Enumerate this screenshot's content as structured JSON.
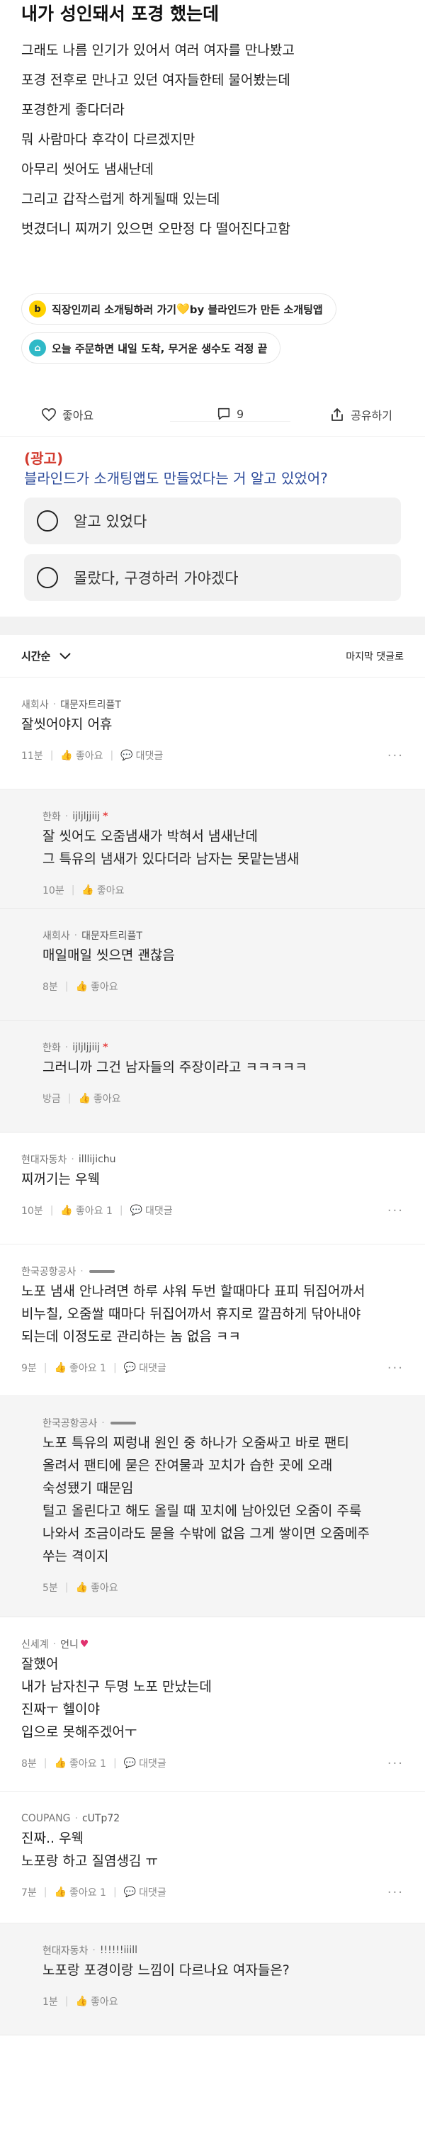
{
  "post": {
    "title": "내가 성인돼서 포경 했는데",
    "lines": [
      "그래도 나름 인기가 있어서 여러 여자를 만나봤고",
      "포경 전후로 만나고 있던 여자들한테 물어봤는데",
      "포경한게 좋다더라",
      "뭐 사람마다 후각이 다르겠지만",
      "아무리 씻어도 냄새난데",
      "그리고 갑작스럽게 하게될때 있는데",
      "벗겼더니 찌꺼기 있으면 오만정 다 떨어진다고함"
    ]
  },
  "chips": [
    {
      "icon": "b",
      "label": "직장인끼리 소개팅하러 가기",
      "emoji": "💛",
      "label2": " by 블라인드가 만든 소개팅앱"
    },
    {
      "icon": "⌂",
      "label": "오늘 주문하면 내일 도착, 무거운 생수도 걱정 끝"
    }
  ],
  "actions": {
    "like": "좋아요",
    "comment_count": "9",
    "share": "공유하기"
  },
  "ad": {
    "tag": "(광고)",
    "question": "블라인드가 소개팅앱도 만들었다는 거 알고 있었어?",
    "options": [
      "알고 있었다",
      "몰랐다, 구경하러 가야겠다"
    ]
  },
  "sortbar": {
    "sort_label": "시간순",
    "last_link": "마지막 댓글로"
  },
  "comments": [
    {
      "company": "새회사",
      "nick": "대문자트리플T",
      "lines": [
        "잘씻어야지 어휴"
      ],
      "time": "11분",
      "like": "좋아요",
      "reply": "대댓글"
    },
    {
      "company": "한화",
      "nick": "ijljljjiij",
      "lines": [
        "잘 씻어도 오줌냄새가 박혀서 냄새난데",
        "그 특유의 냄새가 있다더라 남자는 못맡는냄새"
      ],
      "time": "10분",
      "like": "좋아요"
    },
    {
      "company": "새회사",
      "nick": "대문자트리플T",
      "lines": [
        "매일매일 씻으면 괜찮음"
      ],
      "time": "8분",
      "like": "좋아요"
    },
    {
      "company": "한화",
      "nick": "ijljljjiij",
      "lines": [
        "그러니까 그건 남자들의 주장이라고 ㅋㅋㅋㅋㅋ"
      ],
      "time": "방금",
      "like": "좋아요"
    },
    {
      "company": "현대자동차",
      "nick": "illlijichu",
      "lines": [
        "찌꺼기는 우웩"
      ],
      "time": "10분",
      "like": "좋아요 1",
      "reply": "대댓글"
    },
    {
      "company": "한국공항공사",
      "nick": "",
      "lines": [
        "노포 냄새 안나려면 하루 샤워 두번 할때마다 표피 뒤집어까서",
        "비누칠, 오줌쌀 때마다 뒤집어까서 휴지로 깔끔하게 닦아내야",
        "되는데 이정도로 관리하는 놈 없음 ㅋㅋ"
      ],
      "time": "9분",
      "like": "좋아요 1",
      "reply": "대댓글"
    },
    {
      "company": "한국공항공사",
      "nick": "",
      "lines": [
        "노포 특유의 찌렁내 원인 중 하나가 오줌싸고 바로 팬티",
        "올려서 팬티에 묻은 잔여물과 꼬치가 습한 곳에 오래",
        "숙성됐기 때문임",
        "털고 올린다고 해도 올릴 때 꼬치에 남아있던 오줌이 주룩",
        "나와서 조금이라도 묻을 수밖에 없음 그게 쌓이면 오줌메주",
        "쑤는 격이지"
      ],
      "time": "5분",
      "like": "좋아요"
    },
    {
      "company": "신세계",
      "nick": "언니",
      "lines": [
        "잘했어",
        "내가 남자친구 두명 노포 만났는데",
        "진짜ㅜ 헬이야",
        "입으로 못해주겠어ㅜ"
      ],
      "time": "8분",
      "like": "좋아요 1",
      "reply": "대댓글"
    },
    {
      "company": "COUPANG",
      "nick": "cUTp72",
      "lines": [
        "진짜.. 우웩",
        "노포랑 하고 질염생김 ㅠ"
      ],
      "time": "7분",
      "like": "좋아요 1",
      "reply": "대댓글"
    },
    {
      "company": "현대자동차",
      "nick": "!!!!!!iiill",
      "lines": [
        "노포랑 포경이랑 느낌이 다르나요 여자들은?"
      ],
      "time": "1분",
      "like": "좋아요"
    }
  ]
}
